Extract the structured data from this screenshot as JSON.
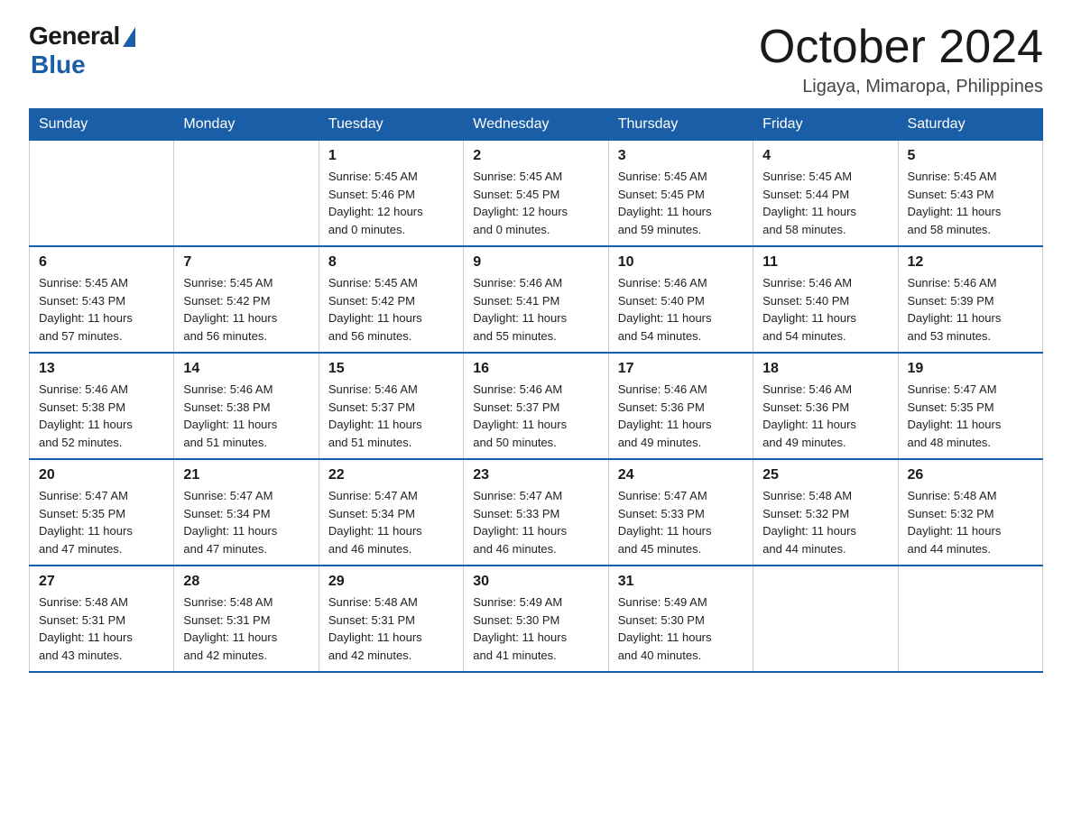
{
  "header": {
    "logo_general": "General",
    "logo_blue": "Blue",
    "month_title": "October 2024",
    "location": "Ligaya, Mimaropa, Philippines"
  },
  "weekdays": [
    "Sunday",
    "Monday",
    "Tuesday",
    "Wednesday",
    "Thursday",
    "Friday",
    "Saturday"
  ],
  "weeks": [
    [
      {
        "day": "",
        "info": ""
      },
      {
        "day": "",
        "info": ""
      },
      {
        "day": "1",
        "info": "Sunrise: 5:45 AM\nSunset: 5:46 PM\nDaylight: 12 hours\nand 0 minutes."
      },
      {
        "day": "2",
        "info": "Sunrise: 5:45 AM\nSunset: 5:45 PM\nDaylight: 12 hours\nand 0 minutes."
      },
      {
        "day": "3",
        "info": "Sunrise: 5:45 AM\nSunset: 5:45 PM\nDaylight: 11 hours\nand 59 minutes."
      },
      {
        "day": "4",
        "info": "Sunrise: 5:45 AM\nSunset: 5:44 PM\nDaylight: 11 hours\nand 58 minutes."
      },
      {
        "day": "5",
        "info": "Sunrise: 5:45 AM\nSunset: 5:43 PM\nDaylight: 11 hours\nand 58 minutes."
      }
    ],
    [
      {
        "day": "6",
        "info": "Sunrise: 5:45 AM\nSunset: 5:43 PM\nDaylight: 11 hours\nand 57 minutes."
      },
      {
        "day": "7",
        "info": "Sunrise: 5:45 AM\nSunset: 5:42 PM\nDaylight: 11 hours\nand 56 minutes."
      },
      {
        "day": "8",
        "info": "Sunrise: 5:45 AM\nSunset: 5:42 PM\nDaylight: 11 hours\nand 56 minutes."
      },
      {
        "day": "9",
        "info": "Sunrise: 5:46 AM\nSunset: 5:41 PM\nDaylight: 11 hours\nand 55 minutes."
      },
      {
        "day": "10",
        "info": "Sunrise: 5:46 AM\nSunset: 5:40 PM\nDaylight: 11 hours\nand 54 minutes."
      },
      {
        "day": "11",
        "info": "Sunrise: 5:46 AM\nSunset: 5:40 PM\nDaylight: 11 hours\nand 54 minutes."
      },
      {
        "day": "12",
        "info": "Sunrise: 5:46 AM\nSunset: 5:39 PM\nDaylight: 11 hours\nand 53 minutes."
      }
    ],
    [
      {
        "day": "13",
        "info": "Sunrise: 5:46 AM\nSunset: 5:38 PM\nDaylight: 11 hours\nand 52 minutes."
      },
      {
        "day": "14",
        "info": "Sunrise: 5:46 AM\nSunset: 5:38 PM\nDaylight: 11 hours\nand 51 minutes."
      },
      {
        "day": "15",
        "info": "Sunrise: 5:46 AM\nSunset: 5:37 PM\nDaylight: 11 hours\nand 51 minutes."
      },
      {
        "day": "16",
        "info": "Sunrise: 5:46 AM\nSunset: 5:37 PM\nDaylight: 11 hours\nand 50 minutes."
      },
      {
        "day": "17",
        "info": "Sunrise: 5:46 AM\nSunset: 5:36 PM\nDaylight: 11 hours\nand 49 minutes."
      },
      {
        "day": "18",
        "info": "Sunrise: 5:46 AM\nSunset: 5:36 PM\nDaylight: 11 hours\nand 49 minutes."
      },
      {
        "day": "19",
        "info": "Sunrise: 5:47 AM\nSunset: 5:35 PM\nDaylight: 11 hours\nand 48 minutes."
      }
    ],
    [
      {
        "day": "20",
        "info": "Sunrise: 5:47 AM\nSunset: 5:35 PM\nDaylight: 11 hours\nand 47 minutes."
      },
      {
        "day": "21",
        "info": "Sunrise: 5:47 AM\nSunset: 5:34 PM\nDaylight: 11 hours\nand 47 minutes."
      },
      {
        "day": "22",
        "info": "Sunrise: 5:47 AM\nSunset: 5:34 PM\nDaylight: 11 hours\nand 46 minutes."
      },
      {
        "day": "23",
        "info": "Sunrise: 5:47 AM\nSunset: 5:33 PM\nDaylight: 11 hours\nand 46 minutes."
      },
      {
        "day": "24",
        "info": "Sunrise: 5:47 AM\nSunset: 5:33 PM\nDaylight: 11 hours\nand 45 minutes."
      },
      {
        "day": "25",
        "info": "Sunrise: 5:48 AM\nSunset: 5:32 PM\nDaylight: 11 hours\nand 44 minutes."
      },
      {
        "day": "26",
        "info": "Sunrise: 5:48 AM\nSunset: 5:32 PM\nDaylight: 11 hours\nand 44 minutes."
      }
    ],
    [
      {
        "day": "27",
        "info": "Sunrise: 5:48 AM\nSunset: 5:31 PM\nDaylight: 11 hours\nand 43 minutes."
      },
      {
        "day": "28",
        "info": "Sunrise: 5:48 AM\nSunset: 5:31 PM\nDaylight: 11 hours\nand 42 minutes."
      },
      {
        "day": "29",
        "info": "Sunrise: 5:48 AM\nSunset: 5:31 PM\nDaylight: 11 hours\nand 42 minutes."
      },
      {
        "day": "30",
        "info": "Sunrise: 5:49 AM\nSunset: 5:30 PM\nDaylight: 11 hours\nand 41 minutes."
      },
      {
        "day": "31",
        "info": "Sunrise: 5:49 AM\nSunset: 5:30 PM\nDaylight: 11 hours\nand 40 minutes."
      },
      {
        "day": "",
        "info": ""
      },
      {
        "day": "",
        "info": ""
      }
    ]
  ]
}
